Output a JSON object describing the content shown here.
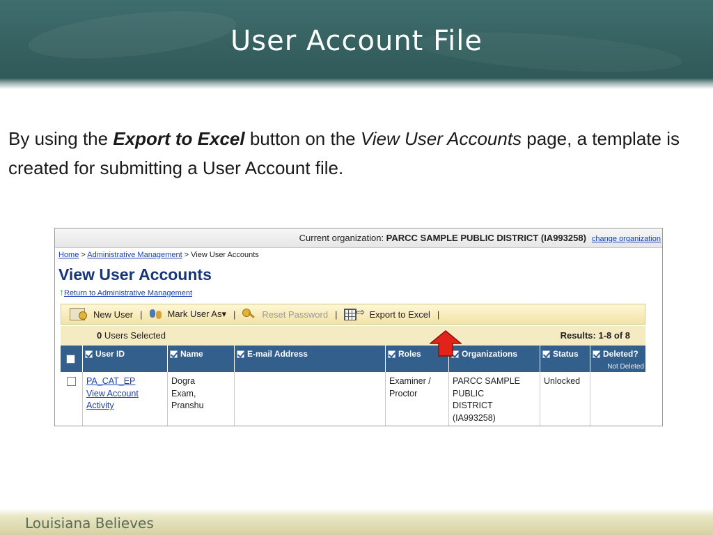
{
  "slide": {
    "title": "User Account File",
    "body_part1": "By using the ",
    "body_bold": "Export to Excel",
    "body_part2": " button on the ",
    "body_italic": "View User Accounts",
    "body_part3": " page, a template is created for submitting a User Account file.",
    "footer": "Louisiana Believes"
  },
  "screenshot": {
    "org_label": "Current organization: ",
    "org_name": "PARCC SAMPLE PUBLIC DISTRICT (IA993258)",
    "change_org": "change organization",
    "breadcrumb": {
      "home": "Home",
      "sep1": " > ",
      "admin": "Administrative Management",
      "sep2": " > ",
      "current": "View User Accounts"
    },
    "page_title": "View User Accounts",
    "return_link": "Return to Administrative Management",
    "toolbar": {
      "new_user": "New User",
      "mark_user": "Mark User As▾",
      "reset_password": "Reset Password",
      "export_excel": "Export to Excel",
      "sep": "|"
    },
    "selection": {
      "count": "0",
      "label": " Users Selected",
      "results": "Results: 1-8 of 8"
    },
    "columns": {
      "user_id": "User ID",
      "name": "Name",
      "email": "E-mail Address",
      "roles": "Roles",
      "organizations": "Organizations",
      "status": "Status",
      "deleted": "Deleted?",
      "deleted_sub": "Not Deleted"
    },
    "row": {
      "user_id_link": "PA_CAT_EP",
      "activity_link_1": "View Account",
      "activity_link_2": "Activity",
      "name_1": "Dogra",
      "name_2": "Exam,",
      "name_3": "Pranshu",
      "email": "",
      "roles_1": "Examiner /",
      "roles_2": "Proctor",
      "org_1": "PARCC SAMPLE",
      "org_2": "PUBLIC",
      "org_3": "DISTRICT",
      "org_4": "(IA993258)",
      "status": "Unlocked",
      "deleted": ""
    }
  },
  "colors": {
    "chalkboard": "#35605f",
    "table_header": "#335f8d",
    "toolbar_bg": "#f2e3a7",
    "heading_blue": "#17357a",
    "arrow_red": "#e2231a"
  }
}
